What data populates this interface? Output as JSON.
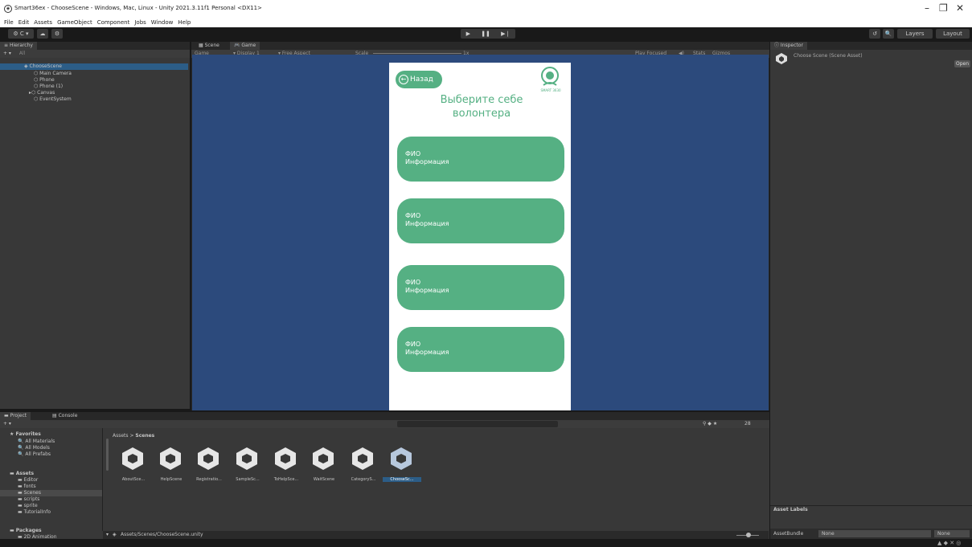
{
  "window": {
    "title": "Smart36ex - ChooseScene - Windows, Mac, Linux - Unity 2021.3.11f1 Personal <DX11>",
    "controls": [
      "–",
      "❐",
      "✕"
    ]
  },
  "menu": [
    "File",
    "Edit",
    "Assets",
    "GameObject",
    "Component",
    "Jobs",
    "Window",
    "Help"
  ],
  "toolbar": {
    "account": "⚙ C ▾",
    "cloud": "☁",
    "collab": "⚙",
    "play": "▶",
    "pause": "❚❚",
    "step": "▶❘",
    "history": "↺",
    "search": "🔍",
    "layers": "Layers",
    "layout": "Layout"
  },
  "hierarchy": {
    "tab": "Hierarchy",
    "search_placeholder": "All",
    "items": [
      {
        "label": "ChooseScene",
        "depth": 0
      },
      {
        "label": "Main Camera",
        "depth": 1
      },
      {
        "label": "Phone",
        "depth": 1
      },
      {
        "label": "Phone (1)",
        "depth": 1
      },
      {
        "label": "Canvas",
        "depth": 1
      },
      {
        "label": "EventSystem",
        "depth": 1
      }
    ]
  },
  "scene_tabs": {
    "scene": "Scene",
    "game": "Game"
  },
  "game_toolbar": {
    "game": "Game",
    "display": "Display 1",
    "aspect": "Free Aspect",
    "scale_label": "Scale",
    "scale_value": "1x",
    "play_focused": "Play Focused",
    "stats": "Stats",
    "gizmos": "Gizmos"
  },
  "app_screen": {
    "back_label": "Назад",
    "logo_text": "SMART 3630",
    "title": "Выберите себе волонтера",
    "cards": [
      {
        "name": "ФИО",
        "info": "Информация"
      },
      {
        "name": "ФИО",
        "info": "Информация"
      },
      {
        "name": "ФИО",
        "info": "Информация"
      },
      {
        "name": "ФИО",
        "info": "Информация"
      }
    ]
  },
  "inspector": {
    "tab": "Inspector",
    "asset_title": "Choose Scene (Scene Asset)",
    "open_label": "Open",
    "asset_labels": "Asset Labels",
    "assetbundle_label": "AssetBundle",
    "assetbundle_value": "None",
    "assetbundle_variant": "None"
  },
  "project": {
    "tab_project": "Project",
    "tab_console": "Console",
    "favorites_label": "Favorites",
    "favorites": [
      "All Materials",
      "All Models",
      "All Prefabs"
    ],
    "assets_label": "Assets",
    "folders": [
      "Editor",
      "fonts",
      "Scenes",
      "scripts",
      "sprite",
      "TutorialInfo"
    ],
    "packages_label": "Packages",
    "packages": [
      "2D Animation"
    ],
    "breadcrumb_root": "Assets",
    "breadcrumb_current": "Scenes",
    "assets": [
      "AboutSce...",
      "HelpScene",
      "Registratio...",
      "SampleSc...",
      "ToHelpSce...",
      "WaitScene",
      "CategoryS...",
      "ChooseSc..."
    ],
    "selected_asset_index": 7,
    "path": "Assets/Scenes/ChooseScene.unity",
    "count": "28"
  },
  "colors": {
    "editor_bg": "#383838",
    "game_bg": "#2c4a7c",
    "accent_green": "#55b083",
    "selection_blue": "#2c5d87"
  }
}
